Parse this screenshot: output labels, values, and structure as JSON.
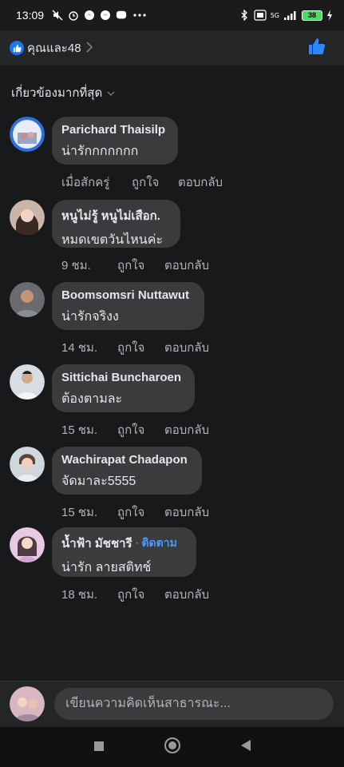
{
  "status_bar": {
    "time": "13:09",
    "battery": "38",
    "network": "5G"
  },
  "header": {
    "reaction_summary": "คุณและ48"
  },
  "sort": {
    "label": "เกี่ยวข้องมากที่สุด"
  },
  "comments": [
    {
      "author": "Parichard Thaisilp",
      "text": "น่ารักกกกกกก",
      "time": "เมื่อสักครู่",
      "like": "ถูกใจ",
      "reply": "ตอบกลับ"
    },
    {
      "author": "หนูไม่รู้ หนูไม่เสือก.",
      "text": "หมดเขตวันไหนค่ะ",
      "time": "9 ชม.",
      "like": "ถูกใจ",
      "reply": "ตอบกลับ"
    },
    {
      "author": "Boomsomsri Nuttawut",
      "text": "น่ารักจริงง",
      "time": "14 ชม.",
      "like": "ถูกใจ",
      "reply": "ตอบกลับ"
    },
    {
      "author": "Sittichai Buncharoen",
      "text": "ต้องตามละ",
      "time": "15 ชม.",
      "like": "ถูกใจ",
      "reply": "ตอบกลับ"
    },
    {
      "author": "Wachirapat Chadapon",
      "text": "จัดมาละ5555",
      "time": "15 ชม.",
      "like": "ถูกใจ",
      "reply": "ตอบกลับ"
    },
    {
      "author": "น้ำฟ้า มัชชารี",
      "follow_sep": "·",
      "follow": "ติดตาม",
      "text": "น่ารัก ลายสติทช์",
      "time": "18 ชม.",
      "like": "ถูกใจ",
      "reply": "ตอบกลับ"
    }
  ],
  "composer": {
    "placeholder": "เขียนความคิดเห็นสาธารณะ..."
  },
  "colors": {
    "background": "#18191a",
    "bubble": "#3a3b3c",
    "accent": "#1877f2",
    "link": "#4599ff"
  }
}
